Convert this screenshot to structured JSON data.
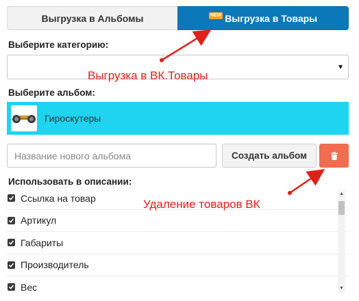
{
  "tabs": [
    {
      "label": "Выгрузка в Альбомы",
      "active": false
    },
    {
      "label": "Выгрузка в Товары",
      "active": true,
      "badge": "NEW"
    }
  ],
  "category": {
    "label": "Выберите категорию:",
    "value": ""
  },
  "album": {
    "label": "Выберите альбом:",
    "selected": "Гироскутеры",
    "thumb_icon": "hoverboard-icon"
  },
  "new_album": {
    "placeholder": "Название нового альбома",
    "create_label": "Создать альбом",
    "delete_icon": "trash-icon"
  },
  "description": {
    "label": "Использовать в описании:",
    "items": [
      {
        "label": "Ссылка на товар",
        "checked": true
      },
      {
        "label": "Артикул",
        "checked": true
      },
      {
        "label": "Габариты",
        "checked": true
      },
      {
        "label": "Производитель",
        "checked": true
      },
      {
        "label": "Вес",
        "checked": true
      }
    ]
  },
  "annotations": {
    "upload_note": "Выгрузка в ВК.Товары",
    "delete_note": "Удаление товаров ВК"
  },
  "colors": {
    "active_tab": "#0b78b9",
    "album_highlight": "#1ed4f1",
    "delete_button": "#f26c4f",
    "annotation": "#e0201a"
  }
}
